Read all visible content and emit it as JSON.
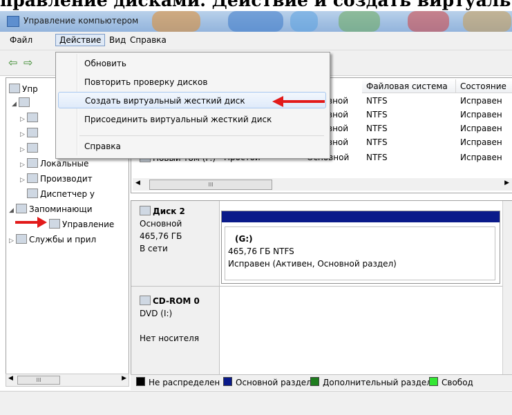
{
  "caption": "правление дисками. Действие и создать виртуаль",
  "window": {
    "title": "Управление компьютером"
  },
  "menubar": {
    "file": "Файл",
    "action": "Действие",
    "view": "Вид",
    "help": "Справка"
  },
  "action_menu": {
    "items": [
      "Обновить",
      "Повторить проверку дисков",
      "Создать виртуальный жесткий диск",
      "Присоединить виртуальный жесткий диск",
      "Справка"
    ]
  },
  "tree": {
    "items": [
      "Упр",
      "Локальные",
      "Производит",
      "Диспетчер у",
      "Запоминающи",
      "Управление",
      "Службы и прил"
    ]
  },
  "volume_table": {
    "headers": [
      "Файловая система",
      "Состояние"
    ],
    "rows": [
      {
        "type": "вной",
        "fs": "NTFS",
        "status": "Исправен"
      },
      {
        "type": "вной",
        "fs": "NTFS",
        "status": "Исправен"
      },
      {
        "type": "вной",
        "fs": "NTFS",
        "status": "Исправен"
      },
      {
        "type": "вной",
        "fs": "NTFS",
        "status": "Исправен"
      },
      {
        "name": "Новый том (F:)",
        "layout": "Простой",
        "type": "Основной",
        "fs": "NTFS",
        "status": "Исправен"
      }
    ]
  },
  "disks": [
    {
      "name": "Диск 2",
      "kind": "Основной",
      "size": "465,76 ГБ",
      "state": "В сети",
      "partition": {
        "label": "(G:)",
        "size_fs": "465,76 ГБ NTFS",
        "health": "Исправен (Активен, Основной раздел)"
      }
    },
    {
      "name": "CD-ROM 0",
      "kind": "DVD (I:)",
      "state": "Нет носителя"
    }
  ],
  "legend": [
    {
      "label": "Не распределен",
      "color": "#000000"
    },
    {
      "label": "Основной раздел",
      "color": "#0a1a8a"
    },
    {
      "label": "Дополнительный раздел",
      "color": "#1e7d1e"
    },
    {
      "label": "Свобод",
      "color": "#33e633"
    }
  ],
  "scroll_grip": "III"
}
